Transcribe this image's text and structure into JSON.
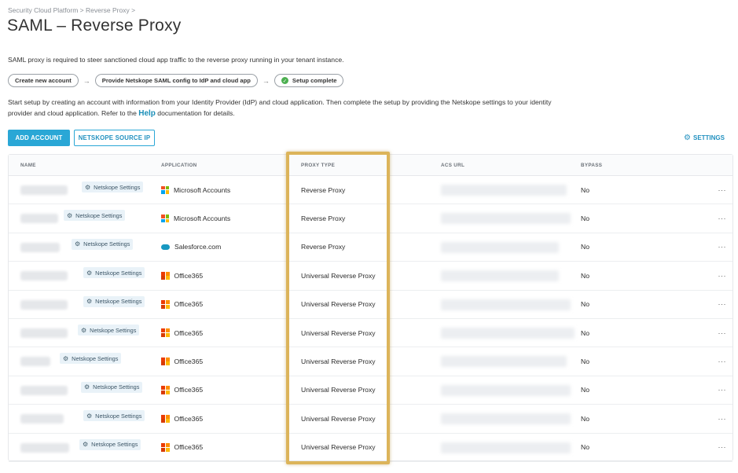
{
  "breadcrumb": "Security Cloud Platform > Reverse Proxy >",
  "title": "SAML – Reverse Proxy",
  "intro": "SAML proxy is required to steer sanctioned cloud app traffic to the reverse proxy running in your tenant instance.",
  "steps": [
    {
      "label": "Create new account"
    },
    {
      "label": "Provide Netskope SAML config to IdP and cloud app"
    },
    {
      "label": "Setup complete"
    }
  ],
  "description": {
    "text_before": "Start setup by creating an account with information from your Identity Provider (IdP) and cloud application. Then complete the setup by providing the Netskope settings to your identity provider and cloud application. Refer to the ",
    "link": "Help",
    "text_after": " documentation for details."
  },
  "toolbar": {
    "add_account": "ADD ACCOUNT",
    "source_ip": "NETSKOPE SOURCE IP",
    "settings": "SETTINGS"
  },
  "table": {
    "columns": [
      "NAME",
      "APPLICATION",
      "PROXY TYPE",
      "ACS URL",
      "BYPASS"
    ],
    "rows": [
      {
        "chip": "Netskope Settings",
        "app": "Microsoft Accounts",
        "icon": "microsoft-icon",
        "proxy": "Reverse Proxy",
        "bypass": "No"
      },
      {
        "chip": "Netskope Settings",
        "app": "Microsoft Accounts",
        "icon": "microsoft-icon",
        "proxy": "Reverse Proxy",
        "bypass": "No"
      },
      {
        "chip": "Netskope Settings",
        "app": "Salesforce.com",
        "icon": "salesforce-icon",
        "proxy": "Reverse Proxy",
        "bypass": "No"
      },
      {
        "chip": "Netskope Settings",
        "app": "Office365",
        "icon": "office365-icon",
        "proxy": "Universal Reverse Proxy",
        "bypass": "No"
      },
      {
        "chip": "Netskope Settings",
        "app": "Office365",
        "icon": "office365-icon",
        "proxy": "Universal Reverse Proxy",
        "bypass": "No"
      },
      {
        "chip": "Netskope Settings",
        "app": "Office365",
        "icon": "office365-icon",
        "proxy": "Universal Reverse Proxy",
        "bypass": "No"
      },
      {
        "chip": "Netskope Settings",
        "app": "Office365",
        "icon": "office365-icon",
        "proxy": "Universal Reverse Proxy",
        "bypass": "No"
      },
      {
        "chip": "Netskope Settings",
        "app": "Office365",
        "icon": "office365-icon",
        "proxy": "Universal Reverse Proxy",
        "bypass": "No"
      },
      {
        "chip": "Netskope Settings",
        "app": "Office365",
        "icon": "office365-icon",
        "proxy": "Universal Reverse Proxy",
        "bypass": "No"
      },
      {
        "chip": "Netskope Settings",
        "app": "Office365",
        "icon": "office365-icon",
        "proxy": "Universal Reverse Proxy",
        "bypass": "No"
      }
    ]
  },
  "colors": {
    "accent": "#2aa7d6",
    "highlight": "#dcb45a",
    "success": "#4caf50"
  }
}
